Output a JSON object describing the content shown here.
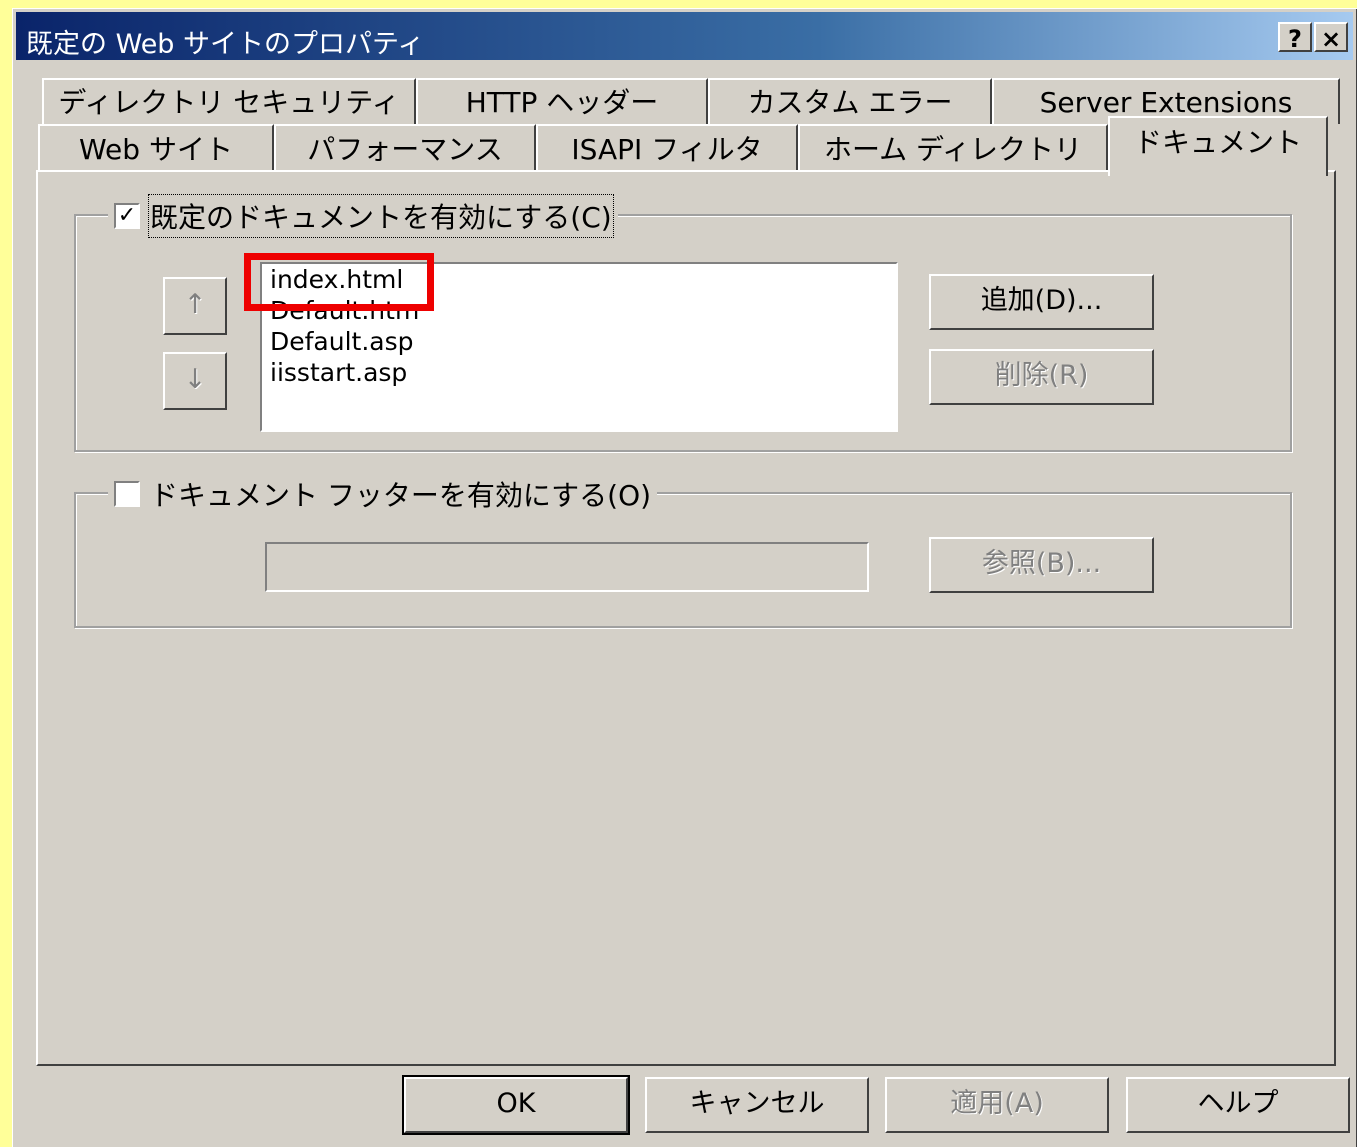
{
  "window": {
    "title": "既定の Web サイトのプロパティ",
    "help_button": "?",
    "close_button": "×"
  },
  "tabs": {
    "row1": [
      "ディレクトリ セキュリティ",
      "HTTP ヘッダー",
      "カスタム エラー",
      "Server Extensions"
    ],
    "row2": [
      "Web サイト",
      "パフォーマンス",
      "ISAPI フィルタ",
      "ホーム ディレクトリ",
      "ドキュメント"
    ],
    "active": "ドキュメント"
  },
  "default_docs": {
    "checkbox_label": "既定のドキュメントを有効にする(C)",
    "checked": true,
    "move_up_glyph": "↑",
    "move_down_glyph": "↓",
    "items": [
      "index.html",
      "Default.htm",
      "Default.asp",
      "iisstart.asp"
    ],
    "add_button": "追加(D)...",
    "remove_button": "削除(R)"
  },
  "footer": {
    "checkbox_label": "ドキュメント フッターを有効にする(O)",
    "checked": false,
    "path_value": "",
    "browse_button": "参照(B)..."
  },
  "buttons": {
    "ok": "OK",
    "cancel": "キャンセル",
    "apply": "適用(A)",
    "help": "ヘルプ"
  },
  "annotation_color": "#ee0000"
}
